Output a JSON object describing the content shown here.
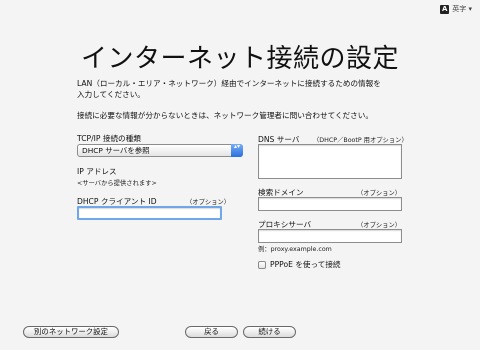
{
  "input_menu": {
    "icon": "A",
    "label": "英字 ▾"
  },
  "title": "インターネット接続の設定",
  "intro": {
    "line1": "LAN（ローカル・エリア・ネットワーク）経由でインターネットに接続するための情報を",
    "line2": "入力してください。",
    "line3": "接続に必要な情報が分からないときは、ネットワーク管理者に問い合わせてください。"
  },
  "tcpip": {
    "label": "TCP/IP 接続の種類",
    "selected": "DHCP サーバを参照",
    "arrows": "▴▾"
  },
  "ip": {
    "label": "IP アドレス",
    "value": "<サーバから提供されます>"
  },
  "dhcp_client": {
    "label": "DHCP クライアント ID",
    "optional": "（オプション）",
    "value": ""
  },
  "dns": {
    "label": "DNS サーバ",
    "optional": "（DHCP／BootP 用オプション）",
    "value": ""
  },
  "search_domain": {
    "label": "検索ドメイン",
    "optional": "（オプション）",
    "value": ""
  },
  "proxy": {
    "label": "プロキシサーバ",
    "optional": "（オプション）",
    "value": "",
    "example": "例：proxy.example.com"
  },
  "pppoe": {
    "label": "PPPoE を使って接続",
    "checked": false
  },
  "buttons": {
    "other_network": "別のネットワーク設定",
    "back": "戻る",
    "continue": "続ける"
  }
}
